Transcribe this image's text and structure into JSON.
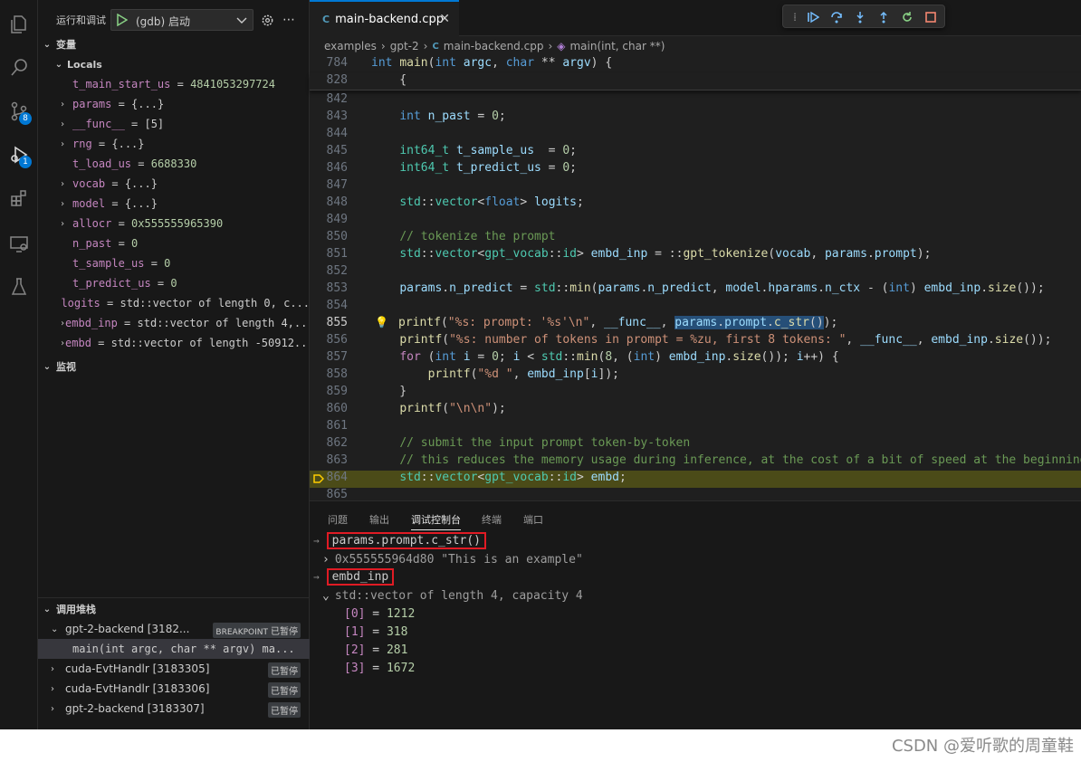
{
  "sidebar": {
    "title": "运行和调试",
    "config": "(gdb) 启动",
    "variables_title": "变量",
    "locals_title": "Locals",
    "locals": [
      {
        "name": "t_main_start_us",
        "eq": " = ",
        "value": "4841053297724",
        "expandable": false,
        "kind": "num"
      },
      {
        "name": "params",
        "eq": " = ",
        "value": "{...}",
        "expandable": true,
        "kind": "obj"
      },
      {
        "name": "__func__",
        "eq": " = ",
        "value": "[5]",
        "expandable": true,
        "kind": "obj"
      },
      {
        "name": "rng",
        "eq": " = ",
        "value": "{...}",
        "expandable": true,
        "kind": "obj"
      },
      {
        "name": "t_load_us",
        "eq": " = ",
        "value": "6688330",
        "expandable": false,
        "kind": "num"
      },
      {
        "name": "vocab",
        "eq": " = ",
        "value": "{...}",
        "expandable": true,
        "kind": "obj"
      },
      {
        "name": "model",
        "eq": " = ",
        "value": "{...}",
        "expandable": true,
        "kind": "obj"
      },
      {
        "name": "allocr",
        "eq": " = ",
        "value": "0x555555965390",
        "expandable": true,
        "kind": "num"
      },
      {
        "name": "n_past",
        "eq": " = ",
        "value": "0",
        "expandable": false,
        "kind": "num"
      },
      {
        "name": "t_sample_us",
        "eq": " = ",
        "value": "0",
        "expandable": false,
        "kind": "num"
      },
      {
        "name": "t_predict_us",
        "eq": " = ",
        "value": "0",
        "expandable": false,
        "kind": "num"
      },
      {
        "name": "logits",
        "eq": " = ",
        "value": "std::vector of length 0, c...",
        "expandable": false,
        "kind": "obj"
      },
      {
        "name": "embd_inp",
        "eq": " = ",
        "value": "std::vector of length 4,...",
        "expandable": true,
        "kind": "obj"
      },
      {
        "name": "embd",
        "eq": " = ",
        "value": "std::vector of length -50912...",
        "expandable": true,
        "kind": "obj"
      }
    ],
    "watch_title": "监视",
    "callstack_title": "调用堆栈",
    "threads": [
      {
        "label": "gpt-2-backend [3182...",
        "badge": "BREAKPOINT",
        "status": "已暂停",
        "expanded": true
      },
      {
        "label": "main(int argc, char ** argv)   ma...",
        "frame": true
      },
      {
        "label": "cuda-EvtHandlr [3183305]",
        "status": "已暂停"
      },
      {
        "label": "cuda-EvtHandlr [3183306]",
        "status": "已暂停"
      },
      {
        "label": "gpt-2-backend [3183307]",
        "status": "已暂停"
      }
    ]
  },
  "editor": {
    "tab_label": "main-backend.cpp",
    "tab_icon": "C",
    "breadcrumb": [
      "examples",
      "gpt-2",
      "main-backend.cpp",
      "main(int, char **)"
    ],
    "lines": [
      {
        "n": "784",
        "html": "<span class='kw'>int</span> <span class='fn'>main</span>(<span class='kw'>int</span> <span class='va'>argc</span>, <span class='kw'>char</span> ** <span class='va'>argv</span>) {"
      },
      {
        "n": "828",
        "html": "    {"
      },
      {
        "n": "842",
        "html": ""
      },
      {
        "n": "843",
        "html": "    <span class='kw'>int</span> <span class='va'>n_past</span> = <span class='nm'>0</span>;"
      },
      {
        "n": "844",
        "html": ""
      },
      {
        "n": "845",
        "html": "    <span class='ty'>int64_t</span> <span class='va'>t_sample_us</span>  = <span class='nm'>0</span>;"
      },
      {
        "n": "846",
        "html": "    <span class='ty'>int64_t</span> <span class='va'>t_predict_us</span> = <span class='nm'>0</span>;"
      },
      {
        "n": "847",
        "html": ""
      },
      {
        "n": "848",
        "html": "    <span class='ty'>std</span>::<span class='ty'>vector</span>&lt;<span class='kw'>float</span>&gt; <span class='va'>logits</span>;"
      },
      {
        "n": "849",
        "html": ""
      },
      {
        "n": "850",
        "html": "    <span class='cm'>// tokenize the prompt</span>"
      },
      {
        "n": "851",
        "html": "    <span class='ty'>std</span>::<span class='ty'>vector</span>&lt;<span class='ty'>gpt_vocab</span>::<span class='ty'>id</span>&gt; <span class='va'>embd_inp</span> = ::<span class='fn'>gpt_tokenize</span>(<span class='va'>vocab</span>, <span class='va'>params</span>.<span class='va'>prompt</span>);"
      },
      {
        "n": "852",
        "html": ""
      },
      {
        "n": "853",
        "html": "    <span class='va'>params</span>.<span class='va'>n_predict</span> = <span class='ty'>std</span>::<span class='fn'>min</span>(<span class='va'>params</span>.<span class='va'>n_predict</span>, <span class='va'>model</span>.<span class='va'>hparams</span>.<span class='va'>n_ctx</span> - (<span class='kw'>int</span>) <span class='va'>embd_inp</span>.<span class='fn'>size</span>());"
      },
      {
        "n": "854",
        "html": ""
      },
      {
        "n": "855",
        "html": "    <span class='fn'>printf</span>(<span class='str'>\"%s: prompt: '%s'\\n\"</span>, <span class='va'>__func__</span>, <span style='background:#264f78'><span class='va'>params</span>.<span class='va'>prompt</span>.<span class='fn'>c_str</span>()</span>);",
        "bulb": true,
        "current": true
      },
      {
        "n": "856",
        "html": "    <span class='fn'>printf</span>(<span class='str'>\"%s: number of tokens in prompt = %zu, first 8 tokens: \"</span>, <span class='va'>__func__</span>, <span class='va'>embd_inp</span>.<span class='fn'>size</span>());"
      },
      {
        "n": "857",
        "html": "    <span class='ctl'>for</span> (<span class='kw'>int</span> <span class='va'>i</span> = <span class='nm'>0</span>; <span class='va'>i</span> &lt; <span class='ty'>std</span>::<span class='fn'>min</span>(<span class='nm'>8</span>, (<span class='kw'>int</span>) <span class='va'>embd_inp</span>.<span class='fn'>size</span>()); <span class='va'>i</span>++) {"
      },
      {
        "n": "858",
        "html": "        <span class='fn'>printf</span>(<span class='str'>\"%d \"</span>, <span class='va'>embd_inp</span>[<span class='va'>i</span>]);"
      },
      {
        "n": "859",
        "html": "    }"
      },
      {
        "n": "860",
        "html": "    <span class='fn'>printf</span>(<span class='str'>\"\\n\\n\"</span>);"
      },
      {
        "n": "861",
        "html": ""
      },
      {
        "n": "862",
        "html": "    <span class='cm'>// submit the input prompt token-by-token</span>"
      },
      {
        "n": "863",
        "html": "    <span class='cm'>// this reduces the memory usage during inference, at the cost of a bit of speed at the beginning</span>"
      },
      {
        "n": "864",
        "html": "    <span class='ty'>std</span>::<span class='ty'>vector</span>&lt;<span class='ty'>gpt_vocab</span>::<span class='ty'>id</span>&gt; <span class='va'>embd</span>;",
        "paused": true
      },
      {
        "n": "865",
        "html": ""
      }
    ]
  },
  "panel": {
    "tabs": [
      "问题",
      "输出",
      "调试控制台",
      "终端",
      "端口"
    ],
    "active_tab": 2,
    "expr1": "params.prompt.c_str()",
    "result1_addr": "0x555555964d80",
    "result1_str": "\"This is an example\"",
    "expr2": "embd_inp",
    "result2": "std::vector of length 4, capacity 4",
    "elements": [
      {
        "idx": "[0]",
        "val": "1212"
      },
      {
        "idx": "[1]",
        "val": "318"
      },
      {
        "idx": "[2]",
        "val": "281"
      },
      {
        "idx": "[3]",
        "val": "1672"
      }
    ]
  },
  "watermark": "CSDN @爱听歌的周童鞋",
  "colors": {
    "accent": "#0078d4",
    "highlight_box": "#e01b24",
    "paused_line": "#4b4b18"
  }
}
